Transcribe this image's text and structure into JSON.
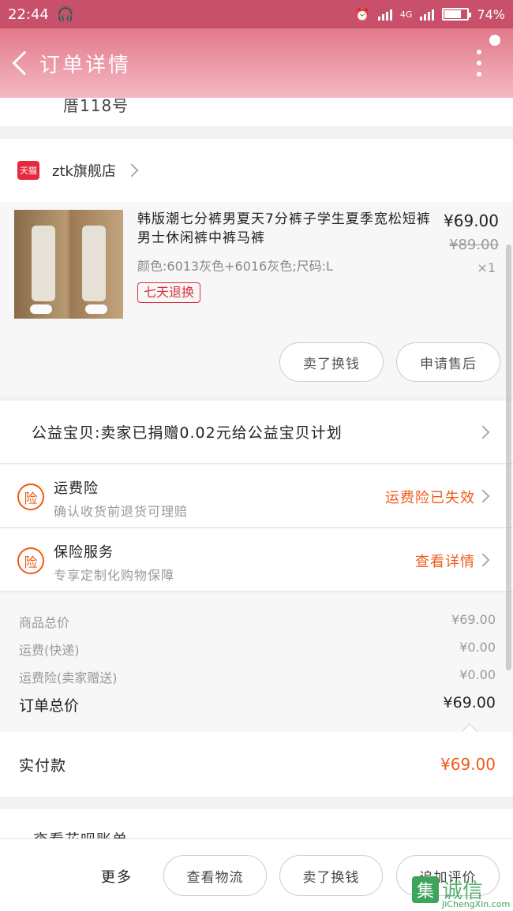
{
  "status_bar": {
    "time": "22:44",
    "network": "4G",
    "battery": "74%",
    "battery_level": 0.74
  },
  "header": {
    "title": "订单详情"
  },
  "address": {
    "partial_text": "厝118号"
  },
  "shop": {
    "name": "ztk旗舰店",
    "tmall_badge": "天猫"
  },
  "product": {
    "title": "韩版潮七分裤男夏天7分裤子学生夏季宽松短裤男士休闲裤中裤马裤",
    "spec": "颜色:6013灰色+6016灰色;尺码:L",
    "badge": "七天退换",
    "price": "¥69.00",
    "original_price": "¥89.00",
    "quantity": "×1",
    "buttons": {
      "sell": "卖了换钱",
      "after_sale": "申请售后"
    }
  },
  "charity": {
    "text": "公益宝贝:卖家已捐赠0.02元给公益宝贝计划"
  },
  "insurance": [
    {
      "icon_text": "险",
      "title": "运费险",
      "subtitle": "确认收货前退货可理赔",
      "status": "运费险已失效"
    },
    {
      "icon_text": "险",
      "title": "保险服务",
      "subtitle": "专享定制化购物保障",
      "status": "查看详情"
    }
  ],
  "summary": {
    "items": [
      {
        "label": "商品总价",
        "value": "¥69.00"
      },
      {
        "label": "运费(快递)",
        "value": "¥0.00"
      },
      {
        "label": "运费险(卖家赠送)",
        "value": "¥0.00"
      }
    ],
    "total_label": "订单总价",
    "total_value": "¥69.00",
    "paid_label": "实付款",
    "paid_value": "¥69.00"
  },
  "partial_row": {
    "text": "查看花呗账单"
  },
  "bottom_bar": {
    "more": "更多",
    "logistics": "查看物流",
    "sell": "卖了换钱",
    "review": "追加评价"
  },
  "watermark": {
    "text": "诚信",
    "icon": "集",
    "sub": "JiChengXin.com"
  },
  "colors": {
    "accent": "#f05b16",
    "header": "#e27a8a",
    "tmall": "#e8283c"
  }
}
